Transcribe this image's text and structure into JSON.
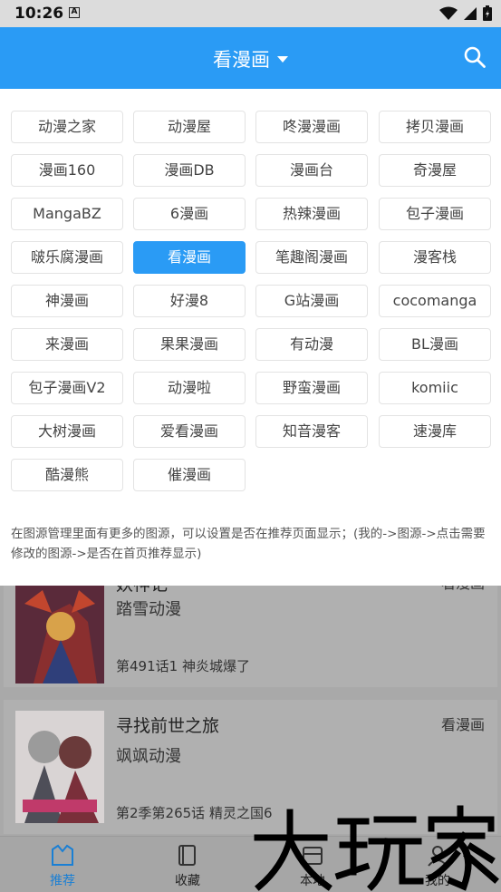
{
  "status_bar": {
    "time": "10:26",
    "a_icon": "A"
  },
  "header": {
    "title": "看漫画",
    "search_icon": "search-icon"
  },
  "sources": [
    "动漫之家",
    "动漫屋",
    "咚漫漫画",
    "拷贝漫画",
    "漫画160",
    "漫画DB",
    "漫画台",
    "奇漫屋",
    "MangaBZ",
    "6漫画",
    "热辣漫画",
    "包子漫画",
    "啵乐腐漫画",
    "看漫画",
    "笔趣阁漫画",
    "漫客栈",
    "神漫画",
    "好漫8",
    "G站漫画",
    "cocomanga",
    "来漫画",
    "果果漫画",
    "有动漫",
    "BL漫画",
    "包子漫画V2",
    "动漫啦",
    "野蛮漫画",
    "komiic",
    "大树漫画",
    "爱看漫画",
    "知音漫客",
    "速漫库",
    "酷漫熊",
    "催漫画"
  ],
  "selected_source": "看漫画",
  "note": "在图源管理里面有更多的图源，可以设置是否在推荐页面显示；(我的->图源->点击需要修改的图源->是否在首页推荐显示)",
  "cards": [
    {
      "title": "妖神记",
      "author": "踏雪动漫",
      "latest": "第491话1 神炎城爆了",
      "source": "看漫画"
    },
    {
      "title": "寻找前世之旅",
      "author": "飒飒动漫",
      "latest": "第2季第265话 精灵之国6",
      "source": "看漫画"
    }
  ],
  "bottom_nav": [
    {
      "label": "推荐",
      "icon": "recommend-icon"
    },
    {
      "label": "收藏",
      "icon": "bookshelf-icon"
    },
    {
      "label": "本地",
      "icon": "local-icon"
    },
    {
      "label": "我的",
      "icon": "profile-icon"
    }
  ],
  "watermark": "大玩家",
  "colors": {
    "primary": "#2a9bf5",
    "chip_border": "#e3e3e3"
  }
}
